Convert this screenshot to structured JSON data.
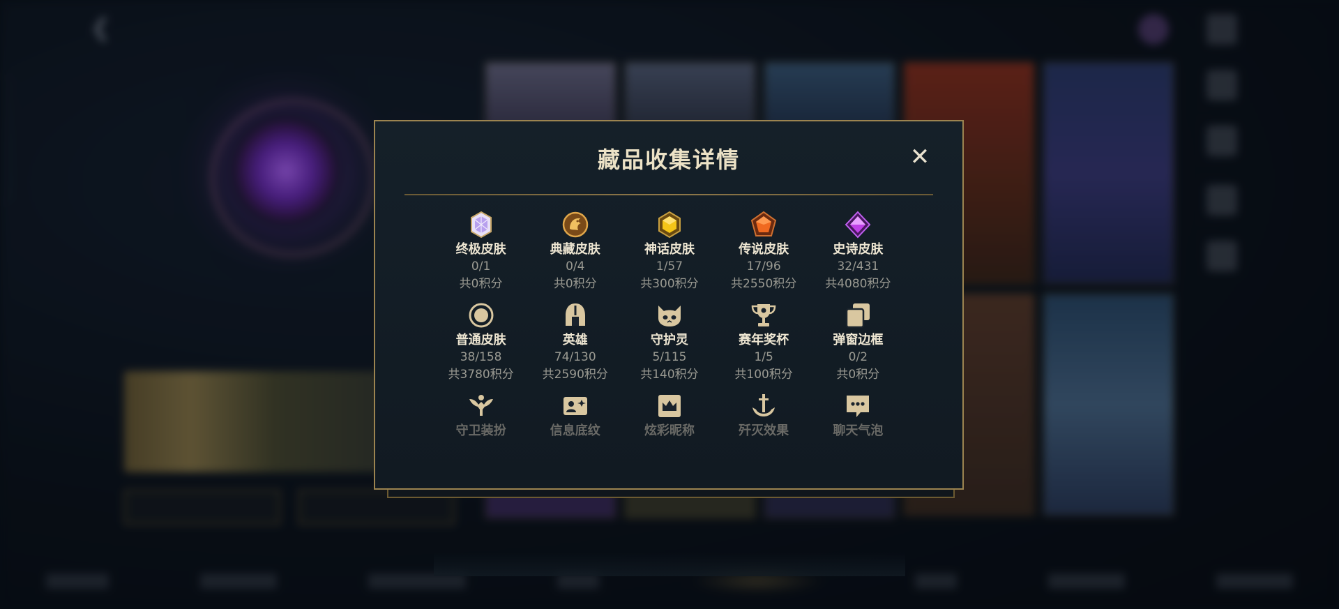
{
  "modal": {
    "title": "藏品收集详情",
    "close_label": "✕",
    "categories": [
      {
        "label": "终极皮肤",
        "count": "0/1",
        "points": "共0积分",
        "icon": "ultimate-gem-icon",
        "color": "#c8b4f0"
      },
      {
        "label": "典藏皮肤",
        "count": "0/4",
        "points": "共0积分",
        "icon": "dragon-emblem-icon",
        "color": "#e0a64a"
      },
      {
        "label": "神话皮肤",
        "count": "1/57",
        "points": "共300积分",
        "icon": "mythic-gem-icon",
        "color": "#f0c020"
      },
      {
        "label": "传说皮肤",
        "count": "17/96",
        "points": "共2550积分",
        "icon": "legendary-gem-icon",
        "color": "#f06a20"
      },
      {
        "label": "史诗皮肤",
        "count": "32/431",
        "points": "共4080积分",
        "icon": "epic-gem-icon",
        "color": "#c040e8"
      },
      {
        "label": "普通皮肤",
        "count": "38/158",
        "points": "共3780积分",
        "icon": "ring-icon",
        "color": "#d9c7a0"
      },
      {
        "label": "英雄",
        "count": "74/130",
        "points": "共2590积分",
        "icon": "helmet-icon",
        "color": "#d9c7a0"
      },
      {
        "label": "守护灵",
        "count": "5/115",
        "points": "共140积分",
        "icon": "guardian-face-icon",
        "color": "#d9c7a0"
      },
      {
        "label": "赛年奖杯",
        "count": "1/5",
        "points": "共100积分",
        "icon": "trophy-icon",
        "color": "#d9c7a0"
      },
      {
        "label": "弹窗边框",
        "count": "0/2",
        "points": "共0积分",
        "icon": "frames-icon",
        "color": "#d9c7a0"
      },
      {
        "label": "守卫装扮",
        "count": "",
        "points": "",
        "icon": "ward-icon",
        "color": "#d9c7a0"
      },
      {
        "label": "信息底纹",
        "count": "",
        "points": "",
        "icon": "profile-card-icon",
        "color": "#d9c7a0"
      },
      {
        "label": "炫彩昵称",
        "count": "",
        "points": "",
        "icon": "crown-card-icon",
        "color": "#d9c7a0"
      },
      {
        "label": "歼灭效果",
        "count": "",
        "points": "",
        "icon": "anchor-icon",
        "color": "#d9c7a0"
      },
      {
        "label": "聊天气泡",
        "count": "",
        "points": "",
        "icon": "chat-bubble-icon",
        "color": "#d9c7a0"
      }
    ]
  },
  "colors": {
    "gold_border": "#9c8450",
    "title_text": "#ece2c6",
    "muted_text": "#9a9a92",
    "panel_bg": "#131e27"
  }
}
